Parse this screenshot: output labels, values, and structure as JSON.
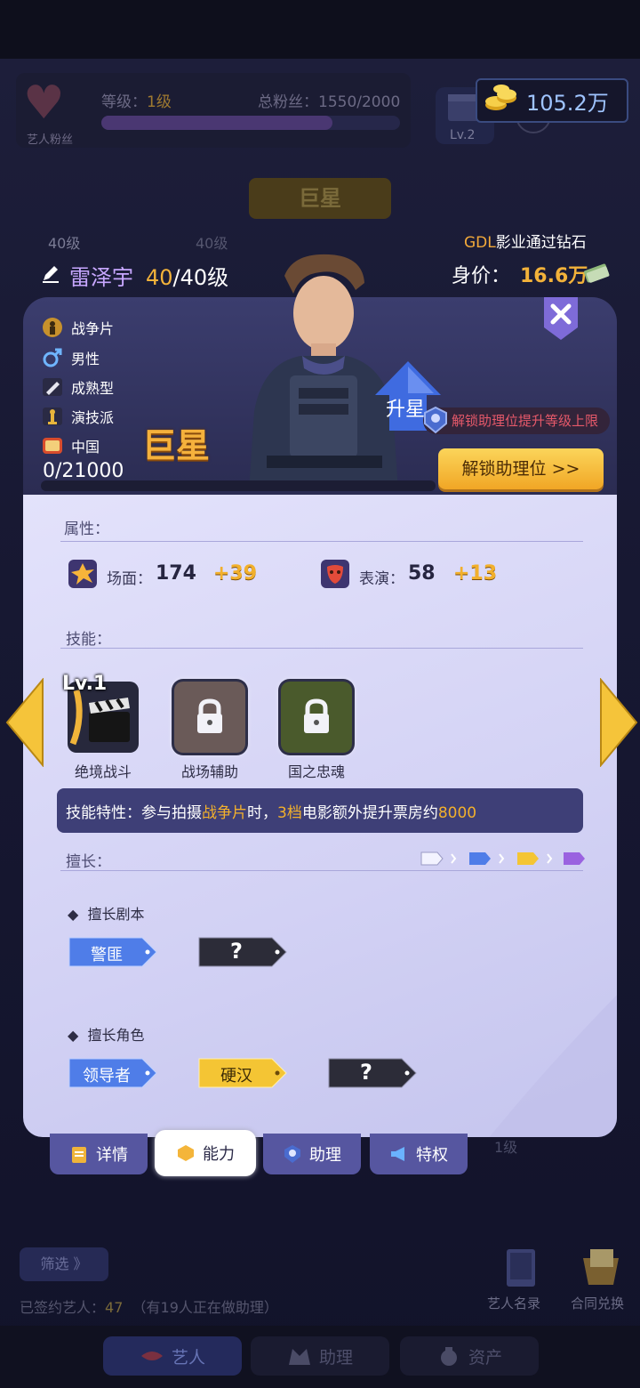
{
  "topbar": {
    "fans_label": "艺人粉丝",
    "level_label": "等级：",
    "level_value": "1级",
    "total_fans_label": "总粉丝：",
    "total_fans_value": "1550/2000",
    "fan_progress": 0.775,
    "badge_level": "Lv.2",
    "help_icon": "?",
    "coins": "105.2万"
  },
  "background": {
    "star_banner": "巨星",
    "ghost_level_a": "40级",
    "ghost_level_b": "40级"
  },
  "marquee": {
    "company": "GDL",
    "text": "影业通过钻石"
  },
  "artist": {
    "name": "雷泽宇",
    "level_current": "40",
    "level_max": "/40级",
    "worth_label": "身价：",
    "worth_value": "16.6万",
    "attributes": [
      {
        "icon": "soldier-icon",
        "label": "战争片"
      },
      {
        "icon": "male-icon",
        "label": "男性"
      },
      {
        "icon": "mature-icon",
        "label": "成熟型"
      },
      {
        "icon": "oscar-icon",
        "label": "演技派"
      },
      {
        "icon": "china-icon",
        "label": "中国"
      }
    ],
    "progress_text": "0/21000",
    "progress": 0,
    "rank_badge": "巨星",
    "upstar_label": "升星",
    "unlock_hint": "解锁助理位提升等级上限",
    "unlock_button": "解锁助理位 >>"
  },
  "detail": {
    "section_attrs": "属性：",
    "stats": [
      {
        "icon": "scene-icon",
        "label": "场面：",
        "value": "174",
        "bonus": "+39"
      },
      {
        "icon": "mask-icon",
        "label": "表演：",
        "value": "58",
        "bonus": "+13"
      }
    ],
    "section_skills": "技能：",
    "skills": [
      {
        "name": "绝境战斗",
        "level": "Lv.1",
        "locked": false
      },
      {
        "name": "战场辅助",
        "locked": true
      },
      {
        "name": "国之忠魂",
        "locked": true
      }
    ],
    "skill_desc": {
      "prefix": "技能特性：参与拍摄",
      "genre": "战争片",
      "mid": "时，",
      "tier": "3档",
      "mid2": "电影额外提升票房约",
      "amount": "8000"
    },
    "section_specialty": "擅长：",
    "scripts_title": "擅长剧本",
    "scripts": [
      {
        "label": "警匪",
        "color": "blue"
      },
      {
        "label": "?",
        "color": "dark"
      }
    ],
    "roles_title": "擅长角色",
    "roles": [
      {
        "label": "领导者",
        "color": "blue"
      },
      {
        "label": "硬汉",
        "color": "gold"
      },
      {
        "label": "?",
        "color": "dark"
      }
    ],
    "tier_colors": [
      "#f3f3ff",
      "#4f7de8",
      "#f4c534",
      "#9a62e0"
    ]
  },
  "tabs": [
    {
      "label": "详情",
      "icon": "clipboard-icon"
    },
    {
      "label": "能力",
      "icon": "hexagon-icon",
      "active": true
    },
    {
      "label": "助理",
      "icon": "assistant-icon"
    },
    {
      "label": "特权",
      "icon": "megaphone-icon"
    }
  ],
  "footer": {
    "filter": "筛选 》",
    "signed_label": "已签约艺人：",
    "signed_count": "47",
    "signed_note": "（有19人正在做助理）",
    "roster": "艺人名录",
    "exchange": "合同兑换",
    "ghost_level": "1级"
  },
  "nav": [
    {
      "label": "艺人",
      "icon": "lips-icon",
      "active": true
    },
    {
      "label": "助理",
      "icon": "suit-icon"
    },
    {
      "label": "资产",
      "icon": "moneybag-icon"
    }
  ]
}
